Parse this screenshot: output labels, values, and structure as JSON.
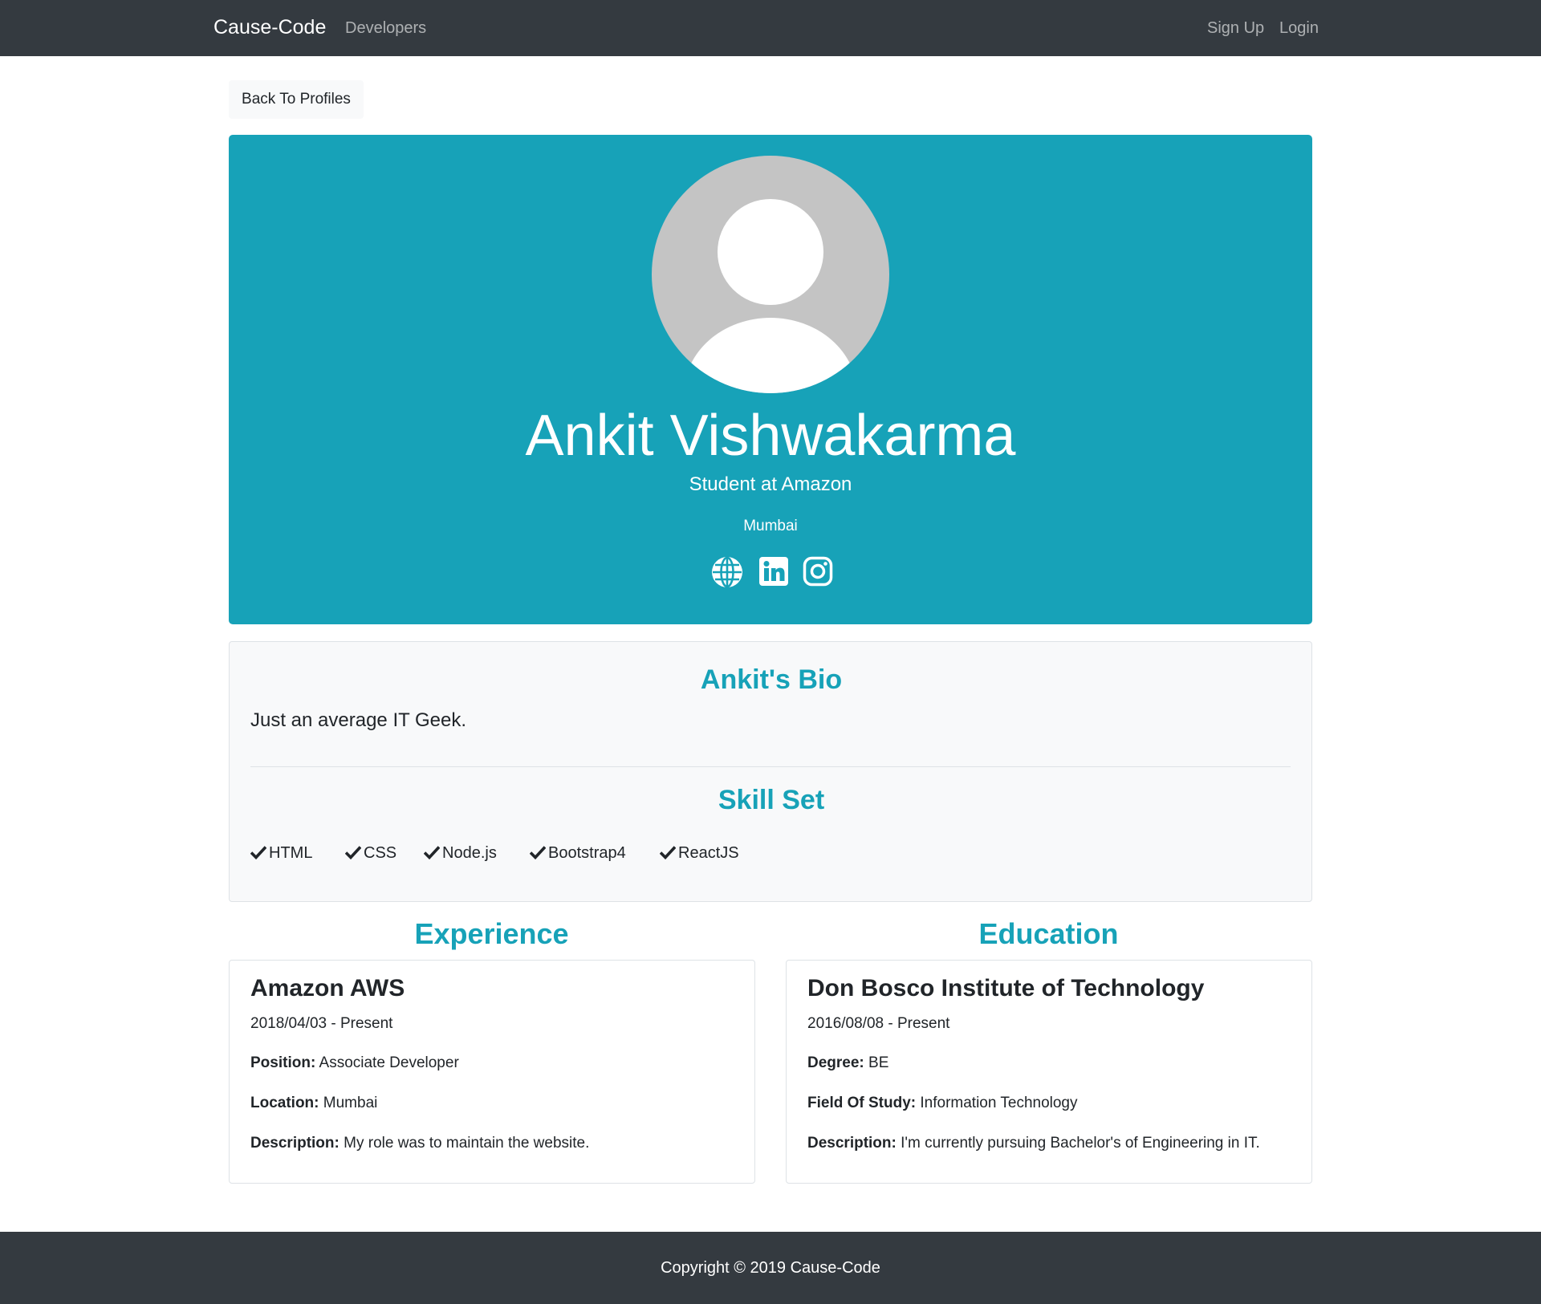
{
  "navbar": {
    "brand": "Cause-Code",
    "developers": "Developers",
    "signup": "Sign Up",
    "login": "Login"
  },
  "back_button": "Back To Profiles",
  "profile": {
    "name": "Ankit Vishwakarma",
    "status": "Student at Amazon",
    "location": "Mumbai",
    "social_icons": [
      "globe-icon",
      "linkedin-icon",
      "instagram-icon"
    ]
  },
  "bio": {
    "title": "Ankit's Bio",
    "text": "Just an average IT Geek.",
    "skills_title": "Skill Set",
    "skills": [
      "HTML",
      "CSS",
      "Node.js",
      "Bootstrap4",
      "ReactJS"
    ]
  },
  "experience": {
    "heading": "Experience",
    "company": "Amazon AWS",
    "dates": "2018/04/03 - Present",
    "position_label": "Position:",
    "position": "Associate Developer",
    "location_label": "Location:",
    "location": "Mumbai",
    "description_label": "Description:",
    "description": "My role was to maintain the website."
  },
  "education": {
    "heading": "Education",
    "school": "Don Bosco Institute of Technology",
    "dates": "2016/08/08 - Present",
    "degree_label": "Degree:",
    "degree": "BE",
    "field_label": "Field Of Study:",
    "field": "Information Technology",
    "description_label": "Description:",
    "description": "I'm currently pursuing Bachelor's of Engineering in IT."
  },
  "footer": {
    "text": "Copyright © 2019 Cause-Code"
  },
  "colors": {
    "navbar": "#343a40",
    "accent": "#17a2b8",
    "card_bg": "#f8f9fa"
  }
}
